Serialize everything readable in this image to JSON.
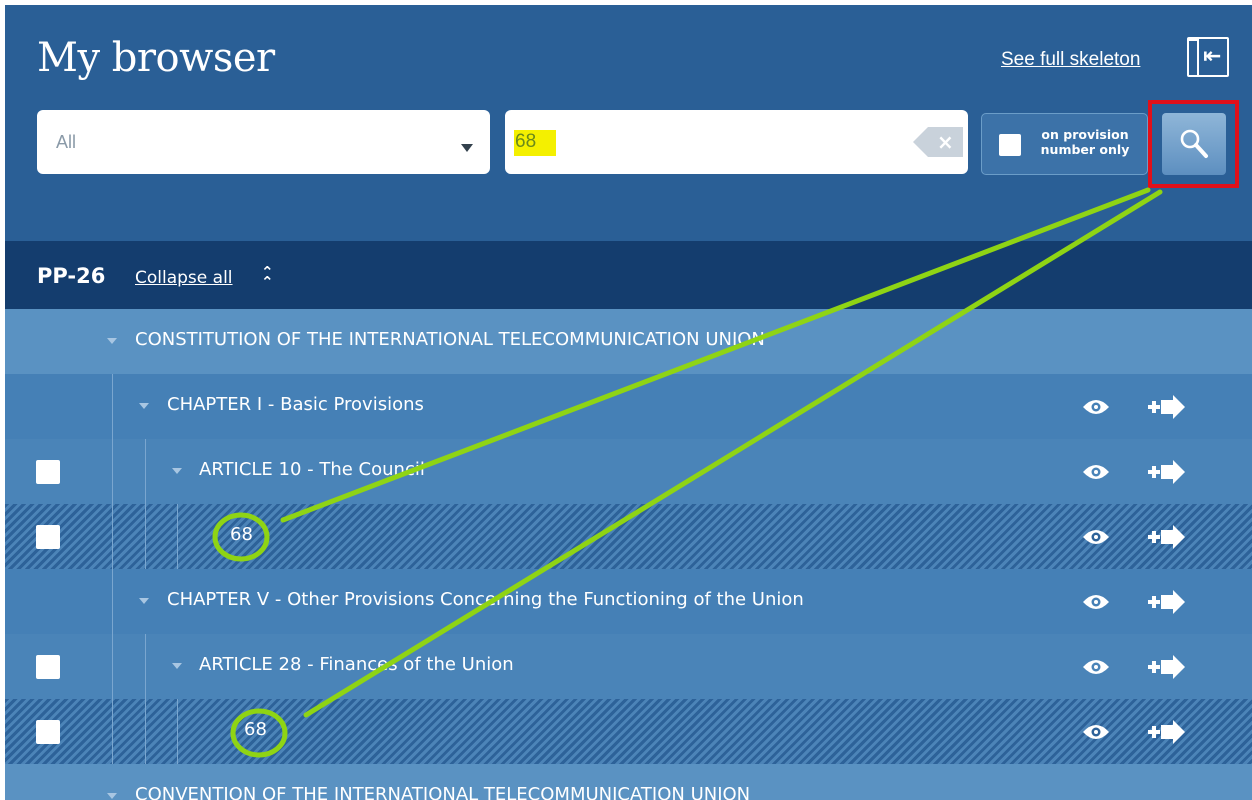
{
  "header": {
    "title": "My browser",
    "skeleton_link": "See full skeleton",
    "scope_select": {
      "value": "All"
    },
    "search": {
      "value": "68"
    },
    "provision_toggle": {
      "label": "on provision number only",
      "checked": false
    }
  },
  "tree": {
    "title": "PP-26",
    "collapse_label": "Collapse all",
    "rows": [
      {
        "label": "CONSTITUTION OF THE INTERNATIONAL TELECOMMUNICATION UNION"
      },
      {
        "label": "CHAPTER I - Basic Provisions"
      },
      {
        "label": "ARTICLE 10 - The Council"
      },
      {
        "label": "68"
      },
      {
        "label": "CHAPTER V - Other Provisions Concerning the Functioning of the Union"
      },
      {
        "label": "ARTICLE 28 - Finances of the Union"
      },
      {
        "label": "68"
      },
      {
        "label": "CONVENTION OF THE INTERNATIONAL TELECOMMUNICATION UNION"
      }
    ]
  },
  "colors": {
    "header_bg": "#2a5f96",
    "tree_header_bg": "#143d6e",
    "highlight": "#f4f000",
    "annotation_green": "#8fd414",
    "annotation_red": "#e0101a"
  }
}
